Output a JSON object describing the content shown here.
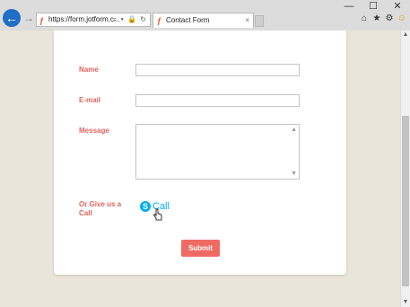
{
  "browser": {
    "address_url": "https://form.jotform.c...",
    "address_controls": "⌕ ▾ 🔒 ↻",
    "tab_title": "Contact Form",
    "tab_close": "×",
    "window_controls": [
      "—",
      "☐",
      "✕"
    ],
    "toolbar_icons": [
      "home-icon",
      "star-icon",
      "gear-icon",
      "smiley-icon"
    ]
  },
  "form": {
    "name_label": "Name",
    "email_label": "E-mail",
    "message_label": "Message",
    "call_label_line1": "Or Give us a",
    "call_label_line2": "Call",
    "call_link_text": "Call",
    "submit_label": "Submit"
  },
  "colors": {
    "label": "#e4645c",
    "submit": "#f06a64",
    "skype": "#00aff0",
    "background": "#eae5da"
  }
}
